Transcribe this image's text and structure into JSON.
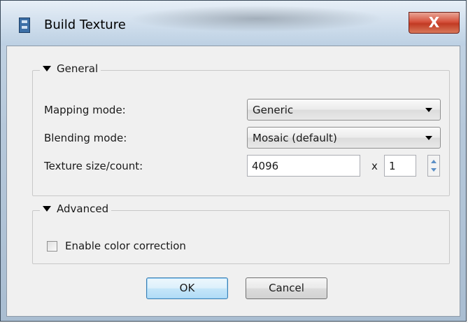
{
  "window": {
    "title": "Build Texture",
    "close_label": "X",
    "icon": "film-icon"
  },
  "general": {
    "header": "General",
    "mapping_label": "Mapping mode:",
    "mapping_value": "Generic",
    "blending_label": "Blending mode:",
    "blending_value": "Mosaic (default)",
    "texture_label": "Texture size/count:",
    "texture_size": "4096",
    "times": "x",
    "texture_count": "1"
  },
  "advanced": {
    "header": "Advanced",
    "color_correction_label": "Enable color correction",
    "color_correction_checked": false
  },
  "buttons": {
    "ok": "OK",
    "cancel": "Cancel"
  }
}
